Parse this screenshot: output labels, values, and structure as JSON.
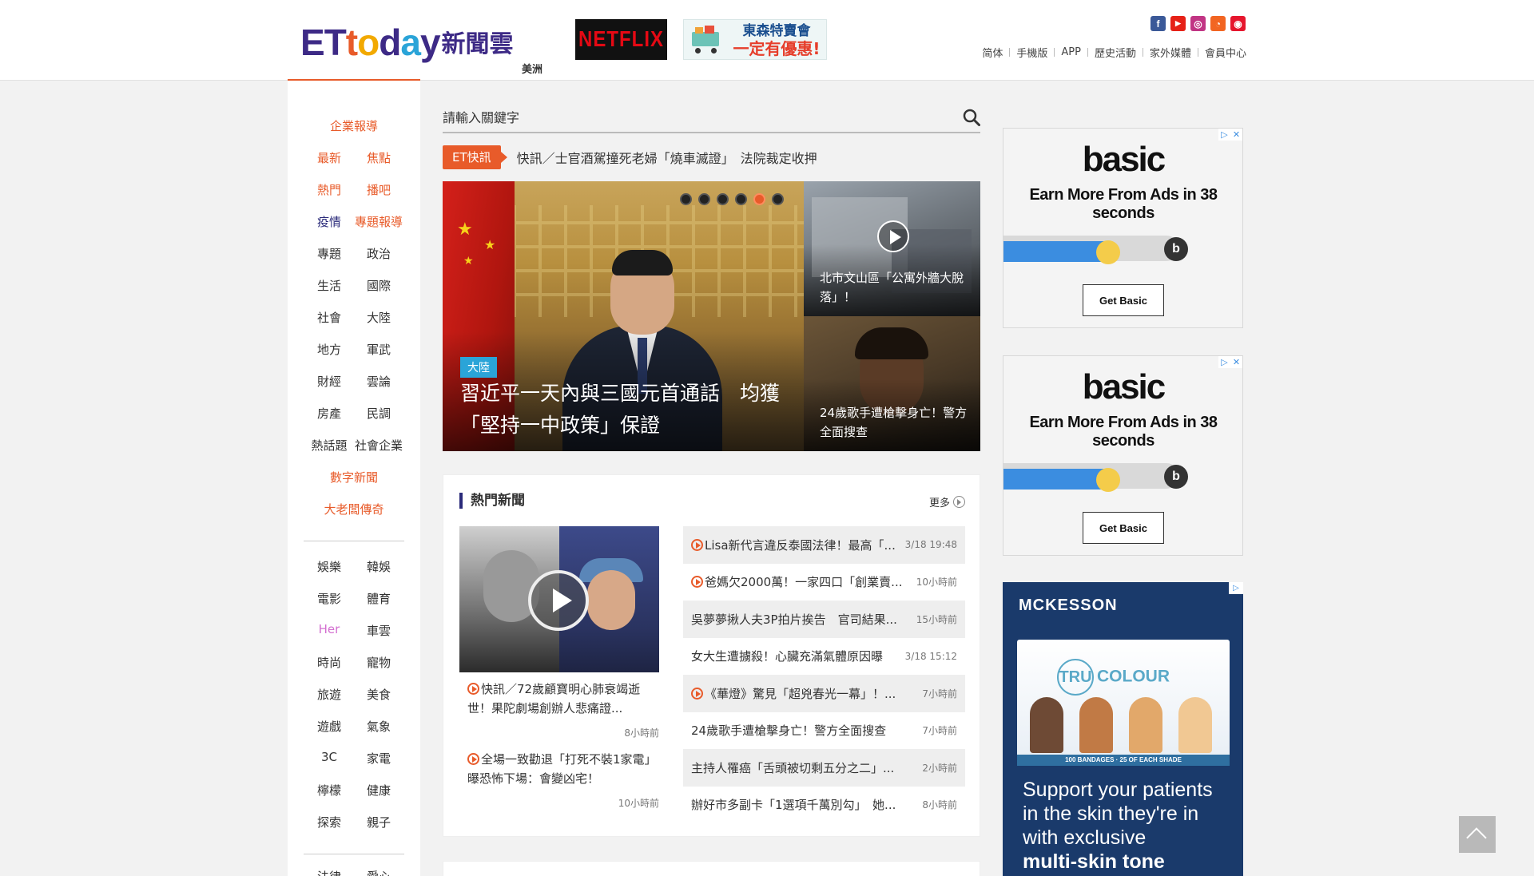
{
  "header": {
    "logo_et": [
      "E",
      "T",
      "t",
      "o",
      "d",
      "a",
      "y"
    ],
    "logo_cn": "新聞雲",
    "region": "美洲",
    "ad_netflix": "NETFLIX",
    "ad_tokyo_line1": "東森特賣會",
    "ad_tokyo_line2": "一定有優惠!",
    "socials": [
      {
        "icon": "facebook-icon",
        "glyph": "f",
        "color": "#3b5998"
      },
      {
        "icon": "youtube-icon",
        "glyph": "▶",
        "color": "#e62117"
      },
      {
        "icon": "instagram-icon",
        "glyph": "◎",
        "color": "#c13584"
      },
      {
        "icon": "rss-icon",
        "glyph": "◔",
        "color": "#f26522"
      },
      {
        "icon": "weibo-icon",
        "glyph": "◉",
        "color": "#e6162d"
      }
    ],
    "links": [
      "简体",
      "手機版",
      "APP",
      "歷史活動",
      "家外媒體",
      "會員中心"
    ]
  },
  "leftnav": {
    "single_top": "企業報導",
    "rows": [
      [
        "最新",
        "焦點"
      ],
      [
        "熱門",
        "播吧"
      ],
      [
        "疫情",
        "專題報導"
      ],
      [
        "專題",
        "政治"
      ],
      [
        "生活",
        "國際"
      ],
      [
        "社會",
        "大陸"
      ],
      [
        "地方",
        "軍武"
      ],
      [
        "財經",
        "雲論"
      ],
      [
        "房產",
        "民調"
      ],
      [
        "熱話題",
        "社會企業"
      ]
    ],
    "single_mid1": "數字新聞",
    "single_mid2": "大老闆傳奇",
    "rows2": [
      [
        "娛樂",
        "韓娛"
      ],
      [
        "電影",
        "體育"
      ],
      [
        "Her",
        "車雲"
      ],
      [
        "時尚",
        "寵物"
      ],
      [
        "旅遊",
        "美食"
      ],
      [
        "遊戲",
        "氣象"
      ],
      [
        "3C",
        "家電"
      ],
      [
        "檸檬",
        "健康"
      ],
      [
        "探索",
        "親子"
      ]
    ],
    "rows3": [
      [
        "法律",
        "愛心"
      ]
    ]
  },
  "search": {
    "placeholder": "請輸入關鍵字"
  },
  "ticker": {
    "tag": "ET快訊",
    "headline": "快訊／士官酒駕撞死老婦「燒車滅證」　法院裁定收押"
  },
  "hero": {
    "category": "大陸",
    "title": "習近平一天內與三國元首通話　均獲「堅持一中政策」保證",
    "dots": 6,
    "active_dot": 5
  },
  "side_stories": [
    "北市文山區「公寓外牆大脫落」！",
    "24歲歌手遭槍擊身亡！警方全面搜查"
  ],
  "hot": {
    "heading": "熱門新聞",
    "more": "更多",
    "lead_stories": [
      {
        "title": "快訊／72歲顧寶明心肺衰竭逝世！果陀劇場創辦人悲痛證...",
        "time": "8小時前"
      },
      {
        "title": "全場一致勸退「打死不裝1家電」　曝恐怖下場：會變凶宅！",
        "time": "10小時前"
      }
    ],
    "list": [
      {
        "title": "Lisa新代言違反泰國法律！最高「...",
        "time": "3/18 19:48",
        "video": true
      },
      {
        "title": "爸媽欠2000萬！一家四口「創業賣...",
        "time": "10小時前",
        "video": true
      },
      {
        "title": "吳夢夢揪人夫3P拍片挨告　官司結果...",
        "time": "15小時前",
        "video": false
      },
      {
        "title": "女大生遭擄殺！心臟充滿氣體原因曝",
        "time": "3/18 15:12",
        "video": false
      },
      {
        "title": "《華燈》驚見「超兇春光一幕」！...",
        "time": "7小時前",
        "video": true
      },
      {
        "title": "24歲歌手遭槍擊身亡！警方全面搜查",
        "time": "7小時前",
        "video": false
      },
      {
        "title": "主持人罹癌「舌頭被切剩五分之二」...",
        "time": "2小時前",
        "video": false
      },
      {
        "title": "辦好市多副卡「1選項千萬別勾」　她...",
        "time": "8小時前",
        "video": false
      }
    ]
  },
  "ads": {
    "basic": {
      "logo": "basic",
      "tagline": "Earn More From Ads in 38 seconds",
      "button": "Get Basic",
      "icon_letter": "b",
      "fill_fraction": 0.59
    },
    "mckesson": {
      "brand": "MCKESSON",
      "product_tru": "TRU",
      "product_colour": "COLOUR",
      "strip": "100 BANDAGES · 25 OF EACH SHADE",
      "copy_1": "Support your patients",
      "copy_2": "in the skin they're in",
      "copy_3": "with exclusive",
      "copy_4": "multi-skin tone"
    }
  },
  "colors": {
    "accent": "#e85b2a",
    "navy": "#2a2a7a",
    "link_blue": "#2aa4d8"
  }
}
